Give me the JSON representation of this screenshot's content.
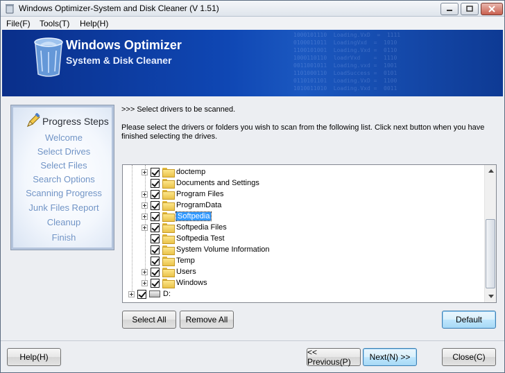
{
  "window": {
    "title": "Windows Optimizer-System and Disk Cleaner (V 1.51)"
  },
  "menu": [
    "File(F)",
    "Tools(T)",
    "Help(H)"
  ],
  "banner": {
    "title": "Windows Optimizer",
    "subtitle": "System & Disk Cleaner"
  },
  "steps": {
    "title": "Progress Steps",
    "items": [
      "Welcome",
      "Select Drives",
      "Select Files",
      "Search Options",
      "Scanning Progress",
      "Junk Files Report",
      "Cleanup",
      "Finish"
    ]
  },
  "prompt": ">>> Select drivers to be scanned.",
  "description": "Please select the drivers or folders you wish to scan from the following list. Click next button when you have finished selecting the drives.",
  "tree": {
    "items": [
      {
        "label": "doctemp",
        "expandable": true,
        "checked": true,
        "icon": "folder-icon"
      },
      {
        "label": "Documents and Settings",
        "expandable": false,
        "checked": true,
        "icon": "folder-icon"
      },
      {
        "label": "Program Files",
        "expandable": true,
        "checked": true,
        "icon": "folder-icon"
      },
      {
        "label": "ProgramData",
        "expandable": true,
        "checked": true,
        "icon": "folder-icon"
      },
      {
        "label": "Softpedia",
        "expandable": true,
        "checked": true,
        "icon": "folder-open-icon",
        "selected": true
      },
      {
        "label": "Softpedia Files",
        "expandable": true,
        "checked": true,
        "icon": "folder-icon"
      },
      {
        "label": "Softpedia Test",
        "expandable": false,
        "checked": true,
        "icon": "folder-icon"
      },
      {
        "label": "System Volume Information",
        "expandable": false,
        "checked": true,
        "icon": "folder-icon"
      },
      {
        "label": "Temp",
        "expandable": false,
        "checked": true,
        "icon": "folder-icon"
      },
      {
        "label": "Users",
        "expandable": true,
        "checked": true,
        "icon": "folder-icon"
      },
      {
        "label": "Windows",
        "expandable": true,
        "checked": true,
        "icon": "folder-icon"
      }
    ],
    "drive": {
      "label": "D:",
      "checked": true,
      "icon": "drive-icon"
    }
  },
  "buttons": {
    "select_all": "Select All",
    "remove_all": "Remove All",
    "default": "Default",
    "help": "Help(H)",
    "previous": "<< Previous(P)",
    "next": "Next(N) >>",
    "close": "Close(C)"
  },
  "colors": {
    "banner": "#0f47b4",
    "steps_text": "#6f93c6",
    "selection": "#3399ff"
  }
}
